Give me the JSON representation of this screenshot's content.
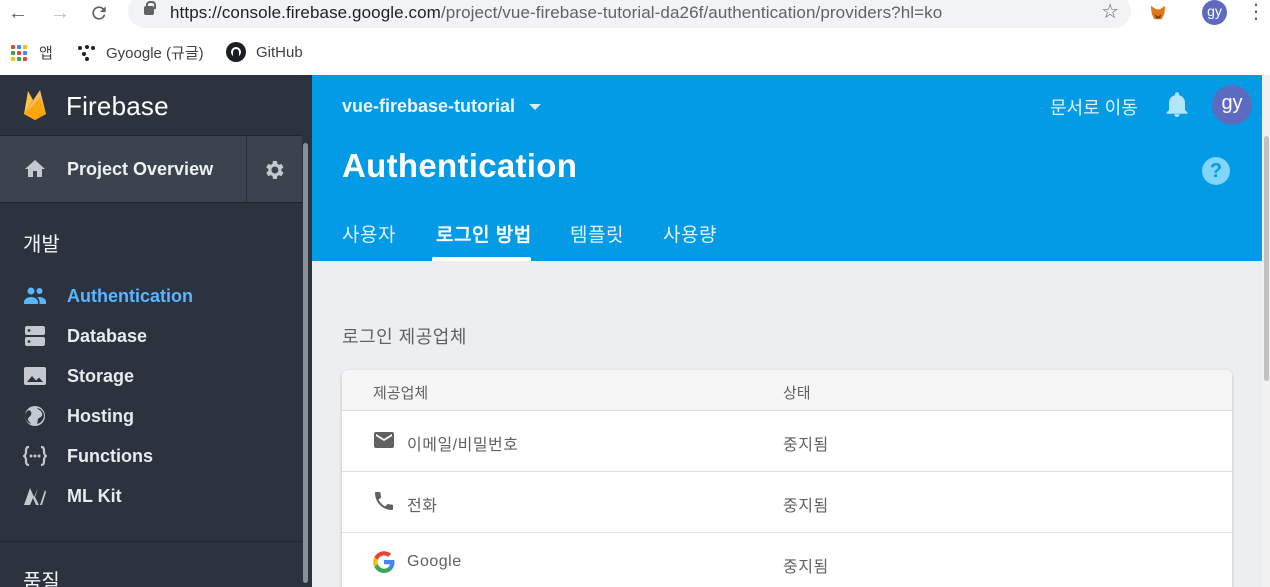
{
  "browser": {
    "url_host": "https://console.firebase.google.com",
    "url_path": "/project/vue-firebase-tutorial-da26f/authentication/providers?hl=ko",
    "profile_initials": "gy",
    "bookmarks": [
      {
        "label": "앱",
        "icon": "apps-grid-icon"
      },
      {
        "label": "Gyoogle (규글)",
        "icon": "dots-icon"
      },
      {
        "label": "GitHub",
        "icon": "github-icon"
      }
    ]
  },
  "sidebar": {
    "brand": "Firebase",
    "overview_label": "Project Overview",
    "section_develop": "개발",
    "items": [
      {
        "label": "Authentication",
        "icon": "people-icon",
        "active": true
      },
      {
        "label": "Database",
        "icon": "database-icon"
      },
      {
        "label": "Storage",
        "icon": "image-icon"
      },
      {
        "label": "Hosting",
        "icon": "globe-icon"
      },
      {
        "label": "Functions",
        "icon": "functions-icon"
      },
      {
        "label": "ML Kit",
        "icon": "ml-kit-icon"
      }
    ],
    "section_quality": "품질"
  },
  "header": {
    "project_name": "vue-firebase-tutorial",
    "docs_link": "문서로 이동",
    "avatar_initials": "gy",
    "title": "Authentication",
    "help": "?",
    "tabs": [
      {
        "label": "사용자"
      },
      {
        "label": "로그인 방법",
        "active": true
      },
      {
        "label": "템플릿"
      },
      {
        "label": "사용량"
      }
    ]
  },
  "providers": {
    "section_title": "로그인 제공업체",
    "columns": [
      "제공업체",
      "상태"
    ],
    "rows": [
      {
        "name": "이메일/비밀번호",
        "status": "중지됨",
        "icon": "mail-icon"
      },
      {
        "name": "전화",
        "status": "중지됨",
        "icon": "phone-icon"
      },
      {
        "name": "Google",
        "status": "중지됨",
        "icon": "google-icon"
      }
    ]
  },
  "colors": {
    "header_blue": "#039be5",
    "sidebar_bg": "#2c333f",
    "active_nav": "#5ab6ff",
    "content_bg": "#eceff1"
  }
}
